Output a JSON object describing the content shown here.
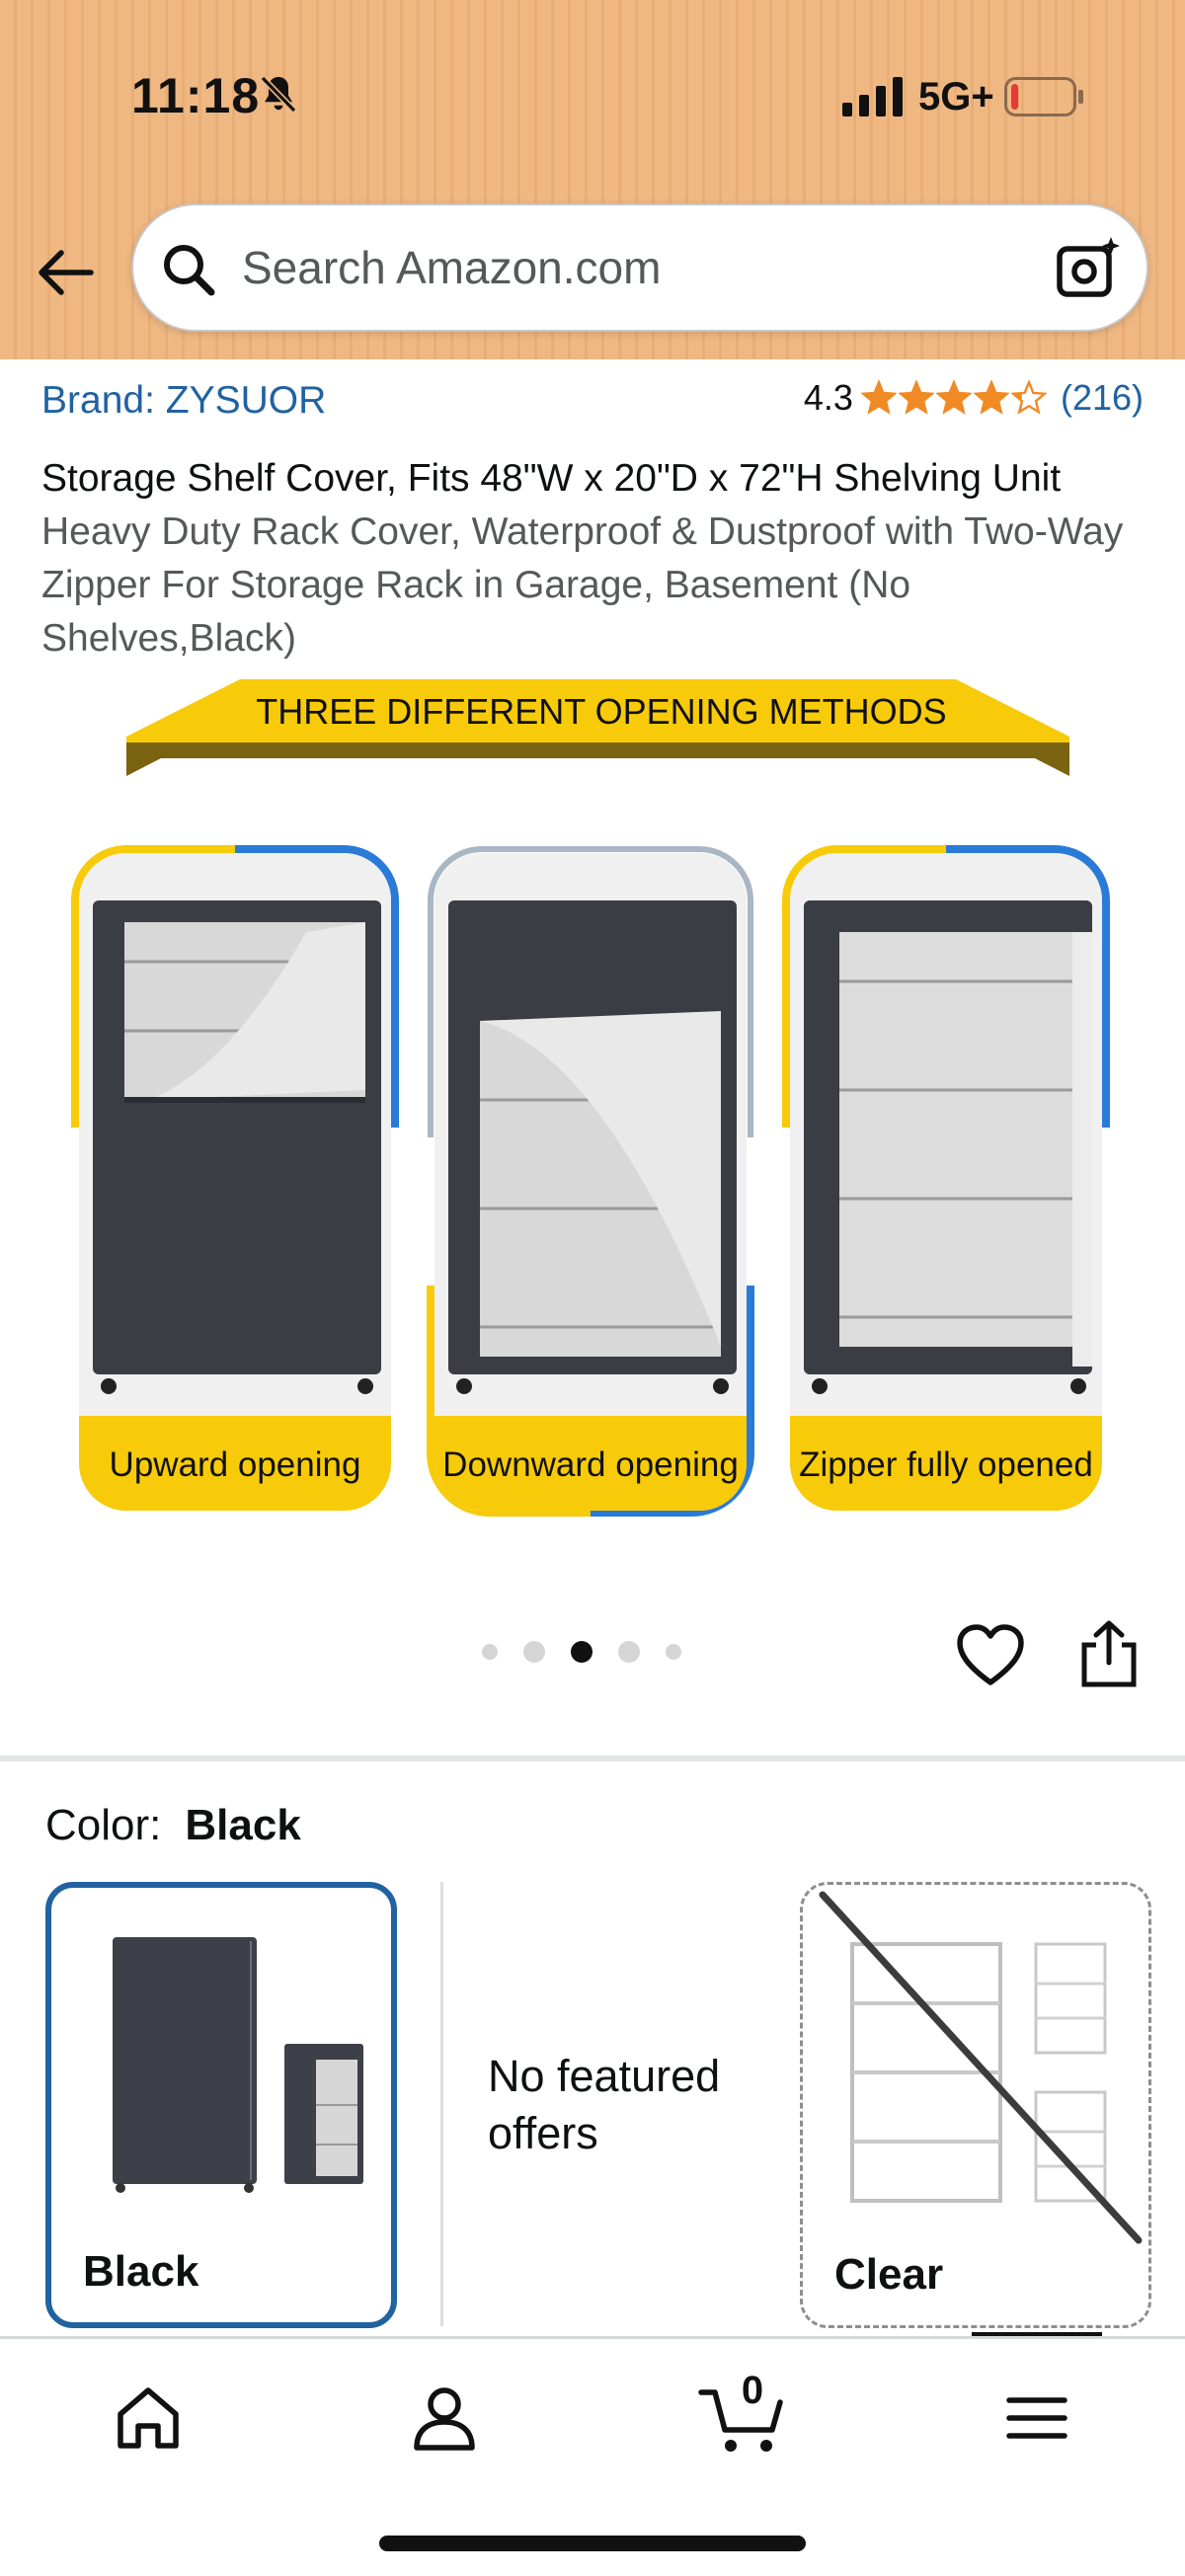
{
  "status_bar": {
    "time": "11:18",
    "network": "5G+",
    "battery_level": 0.12
  },
  "search": {
    "placeholder": "Search Amazon.com"
  },
  "product": {
    "brand": "Brand: ZYSUOR",
    "rating": "4.3",
    "stars": 4.3,
    "rating_count": "(216)",
    "title_main": "Storage Shelf Cover, Fits 48\"W x 20\"D x 72\"H Shelving Unit",
    "title_rest": "Heavy Duty Rack Cover, Waterproof & Dustproof with Two-Way Zipper For Storage Rack in Garage, Basement (No Shelves,Black)"
  },
  "image": {
    "banner_text": "THREE DIFFERENT OPENING METHODS",
    "panels": [
      {
        "label": "Upward opening"
      },
      {
        "label": "Downward opening"
      },
      {
        "label": "Zipper fully opened"
      }
    ],
    "current_index": 3,
    "total": 5
  },
  "variation": {
    "color_label": "Color:",
    "selected_color": "Black",
    "options": [
      {
        "label": "Black"
      },
      {
        "label": "Clear"
      }
    ],
    "no_offers": "No featured offers"
  },
  "nav": {
    "cart_count": "0"
  },
  "colors": {
    "header": "#efb883",
    "link": "#2162a1",
    "star": "#f08a24",
    "banner": "#f7cb0a"
  }
}
